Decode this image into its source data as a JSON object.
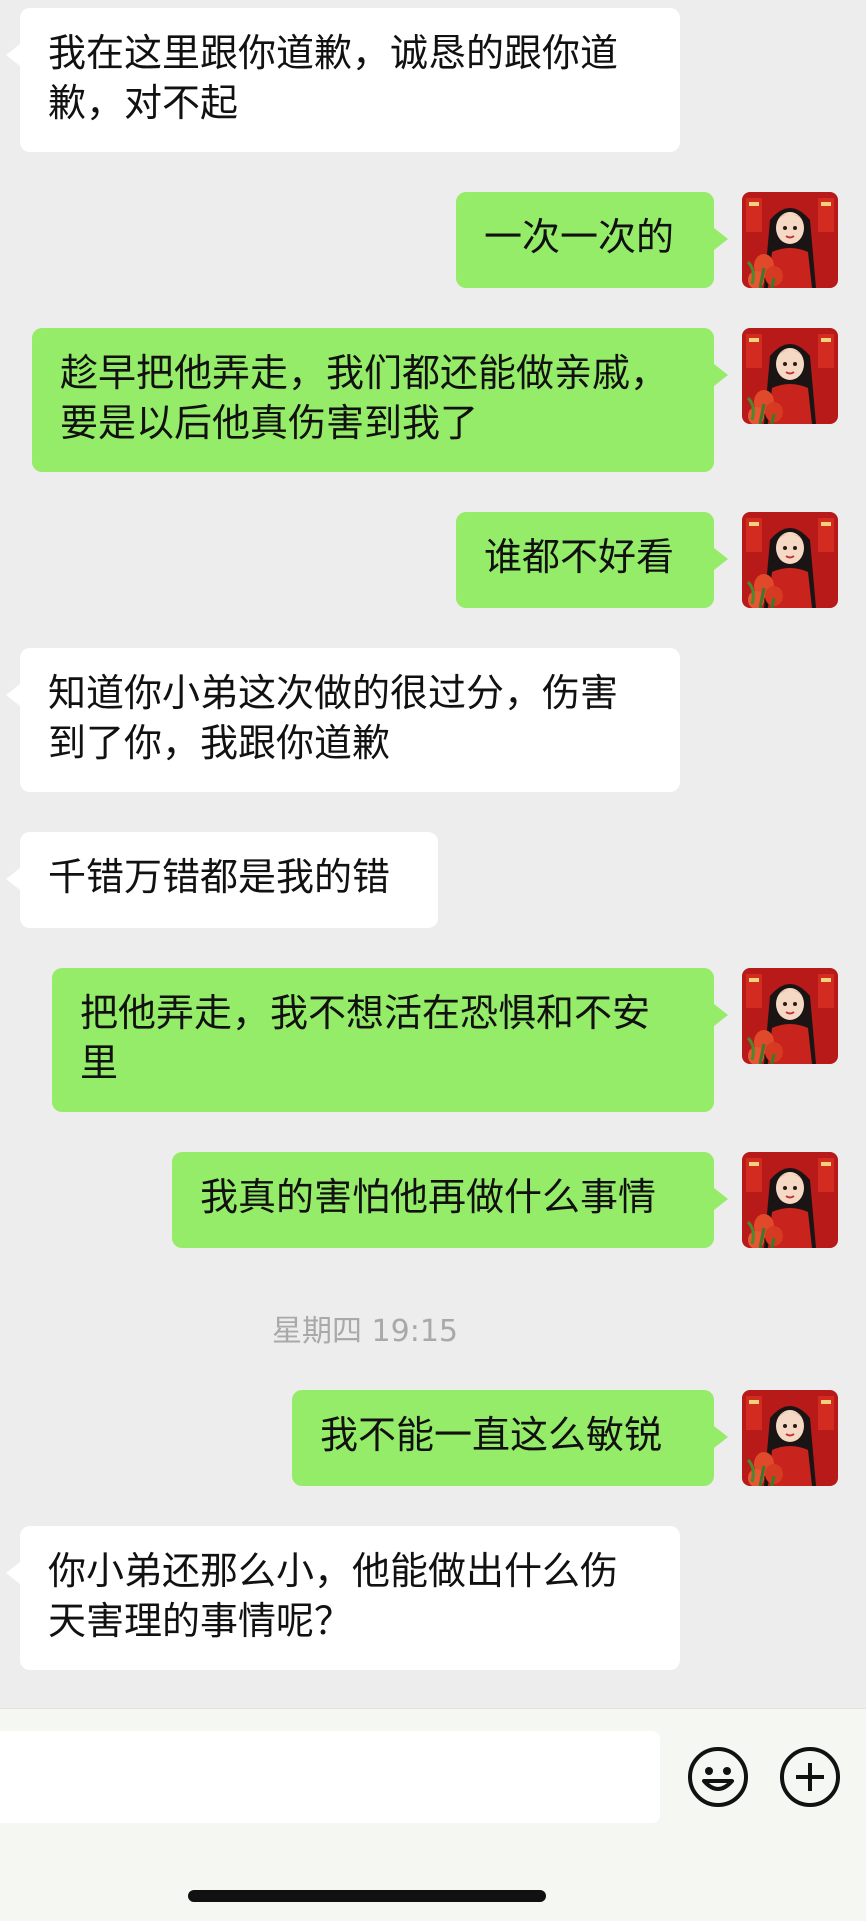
{
  "messages": [
    {
      "side": "in",
      "text": "我在这里跟你道歉，诚恳的跟你道歉，对不起"
    },
    {
      "side": "out",
      "text": "一次一次的"
    },
    {
      "side": "out",
      "text": "趁早把他弄走，我们都还能做亲戚，要是以后他真伤害到我了"
    },
    {
      "side": "out",
      "text": "谁都不好看"
    },
    {
      "side": "in",
      "text": "知道你小弟这次做的很过分，伤害到了你，我跟你道歉"
    },
    {
      "side": "in",
      "text": "千错万错都是我的错"
    },
    {
      "side": "out",
      "text": "把他弄走，我不想活在恐惧和不安里"
    },
    {
      "side": "out",
      "text": "我真的害怕他再做什么事情"
    },
    {
      "side": "out",
      "text": "我不能一直这么敏锐"
    },
    {
      "side": "in",
      "text": "你小弟还那么小，他能做出什么伤天害理的事情呢？"
    }
  ],
  "timestamp": "星期四 19:15",
  "input": {
    "value": "",
    "placeholder": ""
  },
  "icons": {
    "emoji": "smiley-face-icon",
    "plus": "plus-circle-icon",
    "avatar": "user-avatar-icon"
  },
  "colors": {
    "background": "#ededed",
    "incoming_bubble": "#ffffff",
    "outgoing_bubble": "#95ec69",
    "timestamp_text": "#a9a9a9"
  }
}
